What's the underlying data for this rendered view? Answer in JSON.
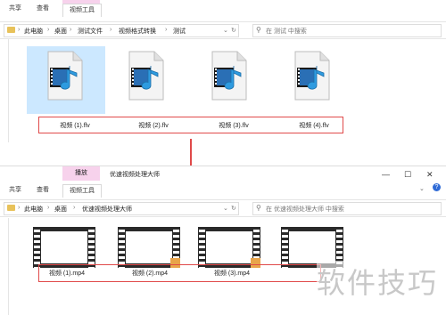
{
  "top": {
    "tabs": [
      "共享",
      "查看"
    ],
    "context_tab": "视频工具",
    "breadcrumb": [
      "此电脑",
      "桌面",
      "测试文件",
      "视频格式转换",
      "测试"
    ],
    "search_placeholder": "在 测试 中搜索",
    "files": [
      "视频 (1).flv",
      "视频 (2).flv",
      "视频 (3).flv",
      "视频 (4).flv"
    ]
  },
  "bottom": {
    "context_header": "播放",
    "window_title": "优速视频处理大师",
    "tabs": [
      "共享",
      "查看"
    ],
    "context_tab": "视频工具",
    "breadcrumb": [
      "此电脑",
      "桌面",
      "优速视频处理大师"
    ],
    "search_placeholder": "在 优速视频处理大师 中搜索",
    "files": [
      "视频 (1).mp4",
      "视频 (2).mp4",
      "视频 (3).mp4"
    ]
  },
  "watermark": "软件技巧",
  "colors": {
    "accent_pink": "#f7d2ec",
    "highlight_red": "#e04a4a",
    "selection_blue": "#cce8ff"
  }
}
